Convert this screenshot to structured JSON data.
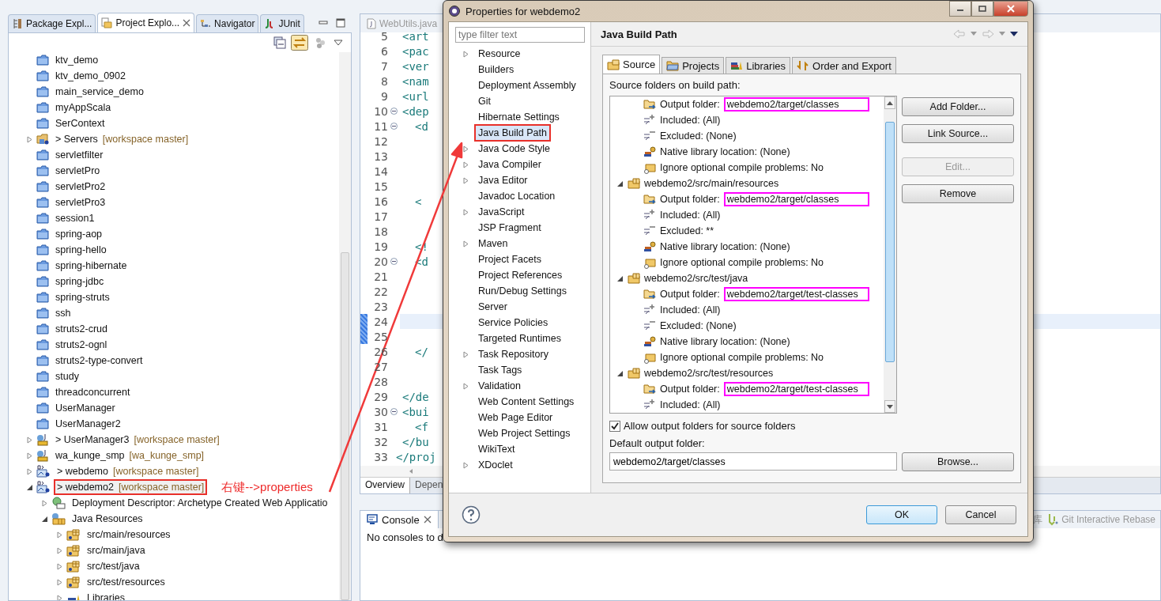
{
  "explorer": {
    "tabs": [
      {
        "label": "Package Expl...",
        "kind": "package",
        "selected": false
      },
      {
        "label": "Project Explo...",
        "kind": "project",
        "selected": true
      },
      {
        "label": "Navigator",
        "kind": "navigator",
        "selected": false
      },
      {
        "label": "JUnit",
        "kind": "junit",
        "selected": false
      }
    ],
    "tree": [
      {
        "name": "ktv_demo",
        "kind": "project",
        "selected": false
      },
      {
        "name": "ktv_demo_0902",
        "kind": "project",
        "selected": false
      },
      {
        "name": "main_service_demo",
        "kind": "project",
        "selected": false
      },
      {
        "name": "myAppScala",
        "kind": "project",
        "selected": false
      },
      {
        "name": "SerContext",
        "kind": "project",
        "selected": false
      },
      {
        "name": "> Servers",
        "repo": "[workspace master]",
        "kind": "server-project",
        "expanded": false,
        "selected": false
      },
      {
        "name": "servletfilter",
        "kind": "project",
        "selected": false
      },
      {
        "name": "servletPro",
        "kind": "project",
        "selected": false
      },
      {
        "name": "servletPro2",
        "kind": "project",
        "selected": false
      },
      {
        "name": "servletPro3",
        "kind": "project",
        "selected": false
      },
      {
        "name": "session1",
        "kind": "project",
        "selected": false
      },
      {
        "name": "spring-aop",
        "kind": "project",
        "selected": false
      },
      {
        "name": "spring-hello",
        "kind": "project",
        "selected": false
      },
      {
        "name": "spring-hibernate",
        "kind": "project",
        "selected": false
      },
      {
        "name": "spring-jdbc",
        "kind": "project",
        "selected": false
      },
      {
        "name": "spring-struts",
        "kind": "project",
        "selected": false
      },
      {
        "name": "ssh",
        "kind": "project",
        "selected": false
      },
      {
        "name": "struts2-crud",
        "kind": "project",
        "selected": false
      },
      {
        "name": "struts2-ognl",
        "kind": "project",
        "selected": false
      },
      {
        "name": "struts2-type-convert",
        "kind": "project",
        "selected": false
      },
      {
        "name": "study",
        "kind": "project",
        "selected": false
      },
      {
        "name": "threadconcurrent",
        "kind": "project",
        "selected": false
      },
      {
        "name": "UserManager",
        "kind": "project",
        "selected": false
      },
      {
        "name": "UserManager2",
        "kind": "project",
        "selected": false
      },
      {
        "name": "> UserManager3",
        "repo": "[workspace master]",
        "kind": "java-project",
        "expanded": false,
        "selected": false
      },
      {
        "name": "wa_kunge_smp",
        "repo": "[wa_kunge_smp]",
        "kind": "java-project",
        "expanded": false,
        "selected": false
      },
      {
        "name": "> webdemo",
        "repo": "[workspace master]",
        "kind": "maven-project",
        "expanded": false,
        "selected": false
      },
      {
        "name": "> webdemo2",
        "repo": "[workspace master]",
        "kind": "maven-project",
        "expanded": true,
        "selected": true,
        "highlight": true,
        "note": "右键-->properties",
        "children": [
          {
            "name": "Deployment Descriptor: Archetype Created Web Applicatio",
            "kind": "descriptor",
            "expanded": false,
            "selected": false
          },
          {
            "name": "Java Resources",
            "kind": "resources",
            "expanded": true,
            "selected": false,
            "children": [
              {
                "name": "src/main/resources",
                "kind": "source-folder",
                "expanded": false,
                "selected": false
              },
              {
                "name": "src/main/java",
                "kind": "source-folder",
                "expanded": false,
                "selected": false
              },
              {
                "name": "src/test/java",
                "kind": "source-folder",
                "expanded": false,
                "selected": false
              },
              {
                "name": "src/test/resources",
                "kind": "source-folder",
                "expanded": false,
                "selected": false
              },
              {
                "name": "Libraries",
                "kind": "library",
                "expanded": false,
                "selected": false
              }
            ]
          }
        ]
      }
    ]
  },
  "editor": {
    "tab": "WebUtils.java",
    "lines": [
      {
        "num": "5",
        "code": "<art",
        "fold": false,
        "current": false
      },
      {
        "num": "6",
        "code": "<pac",
        "fold": false,
        "current": false
      },
      {
        "num": "7",
        "code": "<ver",
        "fold": false,
        "current": false
      },
      {
        "num": "8",
        "code": "<nam",
        "fold": false,
        "current": false
      },
      {
        "num": "9",
        "code": "<url",
        "fold": false,
        "current": false
      },
      {
        "num": "10",
        "code": "<dep",
        "fold": true,
        "current": false
      },
      {
        "num": "11",
        "code": "<d",
        "indent": true,
        "fold": true,
        "current": false
      },
      {
        "num": "12",
        "fold": false,
        "current": false
      },
      {
        "num": "13",
        "fold": false,
        "current": false
      },
      {
        "num": "14",
        "fold": false,
        "current": false
      },
      {
        "num": "15",
        "fold": false,
        "current": false
      },
      {
        "num": "16",
        "code": "<",
        "indent": true,
        "fold": false,
        "current": false
      },
      {
        "num": "17",
        "fold": false,
        "current": false
      },
      {
        "num": "18",
        "fold": false,
        "current": false
      },
      {
        "num": "19",
        "code": "<!",
        "indent": true,
        "fold": false,
        "current": false
      },
      {
        "num": "20",
        "code": "<d",
        "indent": true,
        "fold": true,
        "current": false
      },
      {
        "num": "21",
        "fold": false,
        "current": false
      },
      {
        "num": "22",
        "fold": false,
        "current": false
      },
      {
        "num": "23",
        "fold": false,
        "current": false
      },
      {
        "num": "24",
        "fold": false,
        "current": true
      },
      {
        "num": "25",
        "fold": false,
        "current": false
      },
      {
        "num": "26",
        "code": "</",
        "indent": true,
        "fold": false,
        "current": false
      },
      {
        "num": "27",
        "fold": false,
        "current": false
      },
      {
        "num": "28",
        "fold": false,
        "current": false
      },
      {
        "num": "29",
        "code": "</de",
        "fold": false,
        "current": false
      },
      {
        "num": "30",
        "code": "<bui",
        "fold": true,
        "current": false
      },
      {
        "num": "31",
        "code": "<f",
        "indent": true,
        "fold": false,
        "current": false
      },
      {
        "num": "32",
        "code": "</bu",
        "fold": false,
        "current": false
      },
      {
        "num": "33",
        "code": "</proj",
        "outdent": true,
        "fold": false,
        "current": false
      }
    ],
    "bottom_tabs": [
      {
        "label": "Overview",
        "selected": true
      },
      {
        "label": "Depen",
        "selected": false
      }
    ]
  },
  "console": {
    "title": "Console",
    "message": "No consoles to d",
    "other_tabs": [
      "库",
      "Git Interactive Rebase"
    ]
  },
  "dialog": {
    "title": "Properties for webdemo2",
    "filter": {
      "placeholder": "type filter text"
    },
    "nav": [
      {
        "label": "Resource",
        "expandable": true,
        "selected": false
      },
      {
        "label": "Builders",
        "expandable": false,
        "selected": false
      },
      {
        "label": "Deployment Assembly",
        "expandable": false,
        "selected": false
      },
      {
        "label": "Git",
        "expandable": false,
        "selected": false
      },
      {
        "label": "Hibernate Settings",
        "expandable": false,
        "selected": false
      },
      {
        "label": "Java Build Path",
        "expandable": false,
        "selected": true,
        "highlight": true
      },
      {
        "label": "Java Code Style",
        "expandable": true,
        "selected": false
      },
      {
        "label": "Java Compiler",
        "expandable": true,
        "selected": false
      },
      {
        "label": "Java Editor",
        "expandable": true,
        "selected": false
      },
      {
        "label": "Javadoc Location",
        "expandable": false,
        "selected": false
      },
      {
        "label": "JavaScript",
        "expandable": true,
        "selected": false
      },
      {
        "label": "JSP Fragment",
        "expandable": false,
        "selected": false
      },
      {
        "label": "Maven",
        "expandable": true,
        "selected": false
      },
      {
        "label": "Project Facets",
        "expandable": false,
        "selected": false
      },
      {
        "label": "Project References",
        "expandable": false,
        "selected": false
      },
      {
        "label": "Run/Debug Settings",
        "expandable": false,
        "selected": false
      },
      {
        "label": "Server",
        "expandable": false,
        "selected": false
      },
      {
        "label": "Service Policies",
        "expandable": false,
        "selected": false
      },
      {
        "label": "Targeted Runtimes",
        "expandable": false,
        "selected": false
      },
      {
        "label": "Task Repository",
        "expandable": true,
        "selected": false
      },
      {
        "label": "Task Tags",
        "expandable": false,
        "selected": false
      },
      {
        "label": "Validation",
        "expandable": true,
        "selected": false
      },
      {
        "label": "Web Content Settings",
        "expandable": false,
        "selected": false
      },
      {
        "label": "Web Page Editor",
        "expandable": false,
        "selected": false
      },
      {
        "label": "Web Project Settings",
        "expandable": false,
        "selected": false
      },
      {
        "label": "WikiText",
        "expandable": false,
        "selected": false
      },
      {
        "label": "XDoclet",
        "expandable": true,
        "selected": false
      }
    ],
    "page_title": "Java Build Path",
    "tabs": [
      {
        "label": "Source",
        "kind": "source",
        "selected": true
      },
      {
        "label": "Projects",
        "kind": "projects",
        "selected": false
      },
      {
        "label": "Libraries",
        "kind": "libraries",
        "selected": false
      },
      {
        "label": "Order and Export",
        "kind": "order",
        "selected": false
      }
    ],
    "source_label": "Source folders on build path:",
    "source_folders": [
      {
        "children": [
          {
            "kind": "output",
            "label": "Output folder:",
            "value": "webdemo2/target/classes",
            "highlight": true
          },
          {
            "kind": "included",
            "label": "Included: (All)"
          },
          {
            "kind": "excluded",
            "label": "Excluded: (None)"
          },
          {
            "kind": "native",
            "label": "Native library location: (None)"
          },
          {
            "kind": "ignore",
            "label": "Ignore optional compile problems: No"
          }
        ]
      },
      {
        "path": "webdemo2/src/main/resources",
        "expanded": true,
        "children": [
          {
            "kind": "output",
            "label": "Output folder:",
            "value": "webdemo2/target/classes",
            "highlight": true
          },
          {
            "kind": "included",
            "label": "Included: (All)"
          },
          {
            "kind": "excluded",
            "label": "Excluded: **"
          },
          {
            "kind": "native",
            "label": "Native library location: (None)"
          },
          {
            "kind": "ignore",
            "label": "Ignore optional compile problems: No"
          }
        ]
      },
      {
        "path": "webdemo2/src/test/java",
        "expanded": true,
        "children": [
          {
            "kind": "output",
            "label": "Output folder:",
            "value": "webdemo2/target/test-classes",
            "highlight": true
          },
          {
            "kind": "included",
            "label": "Included: (All)"
          },
          {
            "kind": "excluded",
            "label": "Excluded: (None)"
          },
          {
            "kind": "native",
            "label": "Native library location: (None)"
          },
          {
            "kind": "ignore",
            "label": "Ignore optional compile problems: No"
          }
        ]
      },
      {
        "path": "webdemo2/src/test/resources",
        "expanded": true,
        "children": [
          {
            "kind": "output",
            "label": "Output folder:",
            "value": "webdemo2/target/test-classes",
            "highlight": true
          },
          {
            "kind": "included",
            "label": "Included: (All)"
          }
        ]
      }
    ],
    "side_buttons": [
      {
        "label": "Add Folder...",
        "disabled": false
      },
      {
        "label": "Link Source...",
        "disabled": false
      },
      {
        "label": "Edit...",
        "disabled": true
      },
      {
        "label": "Remove",
        "disabled": false
      }
    ],
    "allow_output": {
      "label": "Allow output folders for source folders",
      "checked": true
    },
    "default_output": {
      "label": "Default output folder:",
      "value": "webdemo2/target/classes",
      "button": "Browse..."
    },
    "buttons": [
      {
        "label": "OK",
        "kind": "default"
      },
      {
        "label": "Cancel",
        "kind": "normal"
      }
    ]
  }
}
